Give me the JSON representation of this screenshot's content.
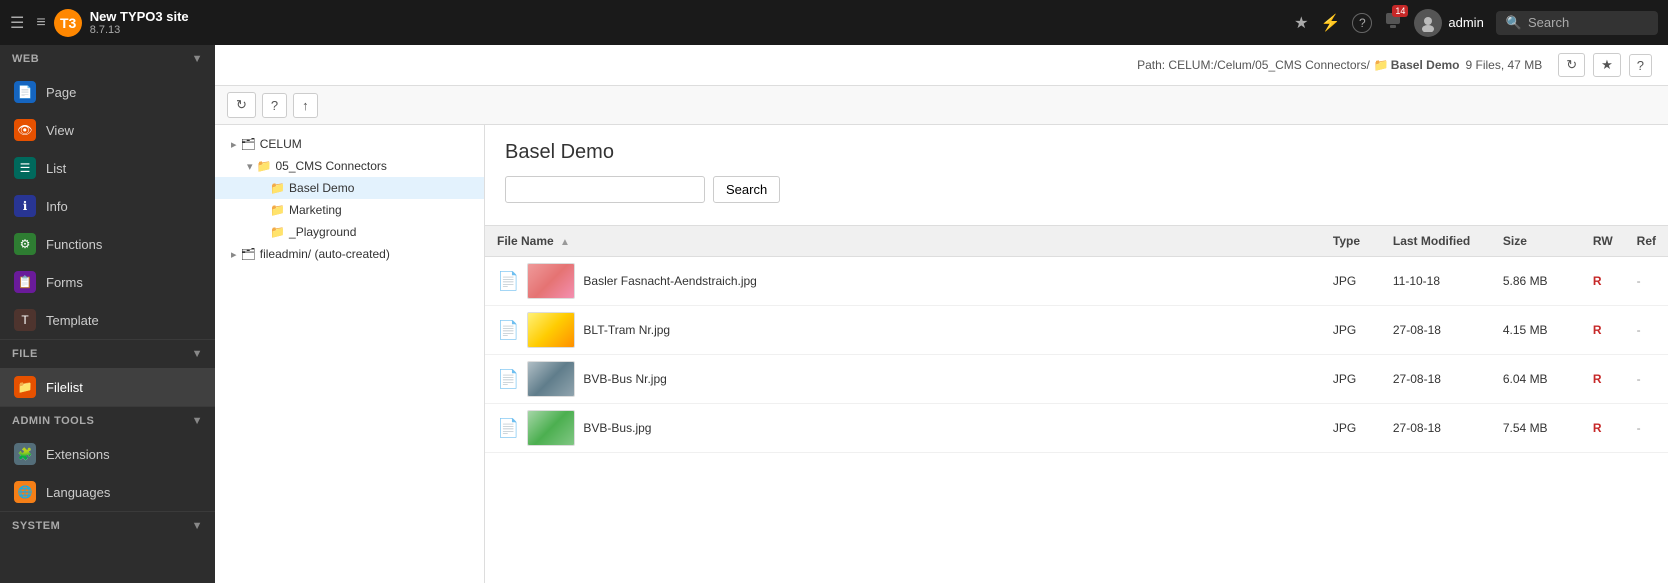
{
  "topbar": {
    "hamburger": "☰",
    "list_view": "≡",
    "site_title": "New TYPO3 site",
    "site_version": "8.7.13",
    "icons": {
      "bookmark": "★",
      "lightning": "⚡",
      "help": "?",
      "bell": "🔔",
      "notification_count": "14",
      "user": "admin",
      "search_placeholder": "Search"
    }
  },
  "sidebar": {
    "web_section": "WEB",
    "web_items": [
      {
        "id": "page",
        "label": "Page",
        "icon": "📄",
        "icon_class": "icon-blue"
      },
      {
        "id": "view",
        "label": "View",
        "icon": "👁",
        "icon_class": "icon-orange"
      },
      {
        "id": "list",
        "label": "List",
        "icon": "☰",
        "icon_class": "icon-teal"
      },
      {
        "id": "info",
        "label": "Info",
        "icon": "ℹ",
        "icon_class": "icon-indigo"
      },
      {
        "id": "functions",
        "label": "Functions",
        "icon": "⚙",
        "icon_class": "icon-green"
      },
      {
        "id": "forms",
        "label": "Forms",
        "icon": "📋",
        "icon_class": "icon-purple"
      },
      {
        "id": "template",
        "label": "Template",
        "icon": "T",
        "icon_class": "icon-brown"
      }
    ],
    "file_section": "FILE",
    "file_items": [
      {
        "id": "filelist",
        "label": "Filelist",
        "icon": "📁",
        "icon_class": "icon-orange"
      }
    ],
    "admin_section": "ADMIN TOOLS",
    "admin_items": [
      {
        "id": "extensions",
        "label": "Extensions",
        "icon": "🧩",
        "icon_class": "icon-gray"
      },
      {
        "id": "languages",
        "label": "Languages",
        "icon": "🌐",
        "icon_class": "icon-amber"
      }
    ],
    "system_section": "SYSTEM"
  },
  "path_bar": {
    "text": "Path: CELUM:/Celum/05_CMS Connectors/",
    "folder_icon": "📁",
    "bold_name": "Basel Demo",
    "file_count": "9 Files, 47 MB"
  },
  "toolbar": {
    "refresh_btn": "↻",
    "help_btn": "?",
    "upload_btn": "↑"
  },
  "tree": {
    "items": [
      {
        "label": "CELUM",
        "indent": "tree-indent-1",
        "icon": "▸",
        "folder": "🗂",
        "type": "root"
      },
      {
        "label": "05_CMS Connectors",
        "indent": "tree-indent-2",
        "icon": "▾",
        "folder": "📁",
        "type": "folder"
      },
      {
        "label": "Basel Demo",
        "indent": "tree-indent-3",
        "icon": "",
        "folder": "📁",
        "type": "folder",
        "selected": true
      },
      {
        "label": "Marketing",
        "indent": "tree-indent-3",
        "icon": "",
        "folder": "📁",
        "type": "folder"
      },
      {
        "label": "_Playground",
        "indent": "tree-indent-3",
        "icon": "",
        "folder": "📁",
        "type": "folder"
      },
      {
        "label": "fileadmin/ (auto-created)",
        "indent": "tree-indent-1",
        "icon": "▸",
        "folder": "🗂",
        "type": "root"
      }
    ]
  },
  "file_panel": {
    "title": "Basel Demo",
    "search_placeholder": "",
    "search_btn": "Search",
    "table_headers": [
      {
        "label": "File Name",
        "sort": true
      },
      {
        "label": "Type"
      },
      {
        "label": "Last Modified"
      },
      {
        "label": "Size"
      },
      {
        "label": "RW"
      },
      {
        "label": "Ref"
      }
    ],
    "files": [
      {
        "name": "Basler Fasnacht-Aendstraich.jpg",
        "type": "JPG",
        "modified": "11-10-18",
        "size": "5.86 MB",
        "rw": "R",
        "ref": "-",
        "thumb_class": "thumb-red"
      },
      {
        "name": "BLT-Tram Nr.jpg",
        "type": "JPG",
        "modified": "27-08-18",
        "size": "4.15 MB",
        "rw": "R",
        "ref": "-",
        "thumb_class": "thumb-yellow"
      },
      {
        "name": "BVB-Bus Nr.jpg",
        "type": "JPG",
        "modified": "27-08-18",
        "size": "6.04 MB",
        "rw": "R",
        "ref": "-",
        "thumb_class": "thumb-blue-gray"
      },
      {
        "name": "BVB-Bus.jpg",
        "type": "JPG",
        "modified": "27-08-18",
        "size": "7.54 MB",
        "rw": "R",
        "ref": "-",
        "thumb_class": "thumb-green"
      }
    ]
  }
}
